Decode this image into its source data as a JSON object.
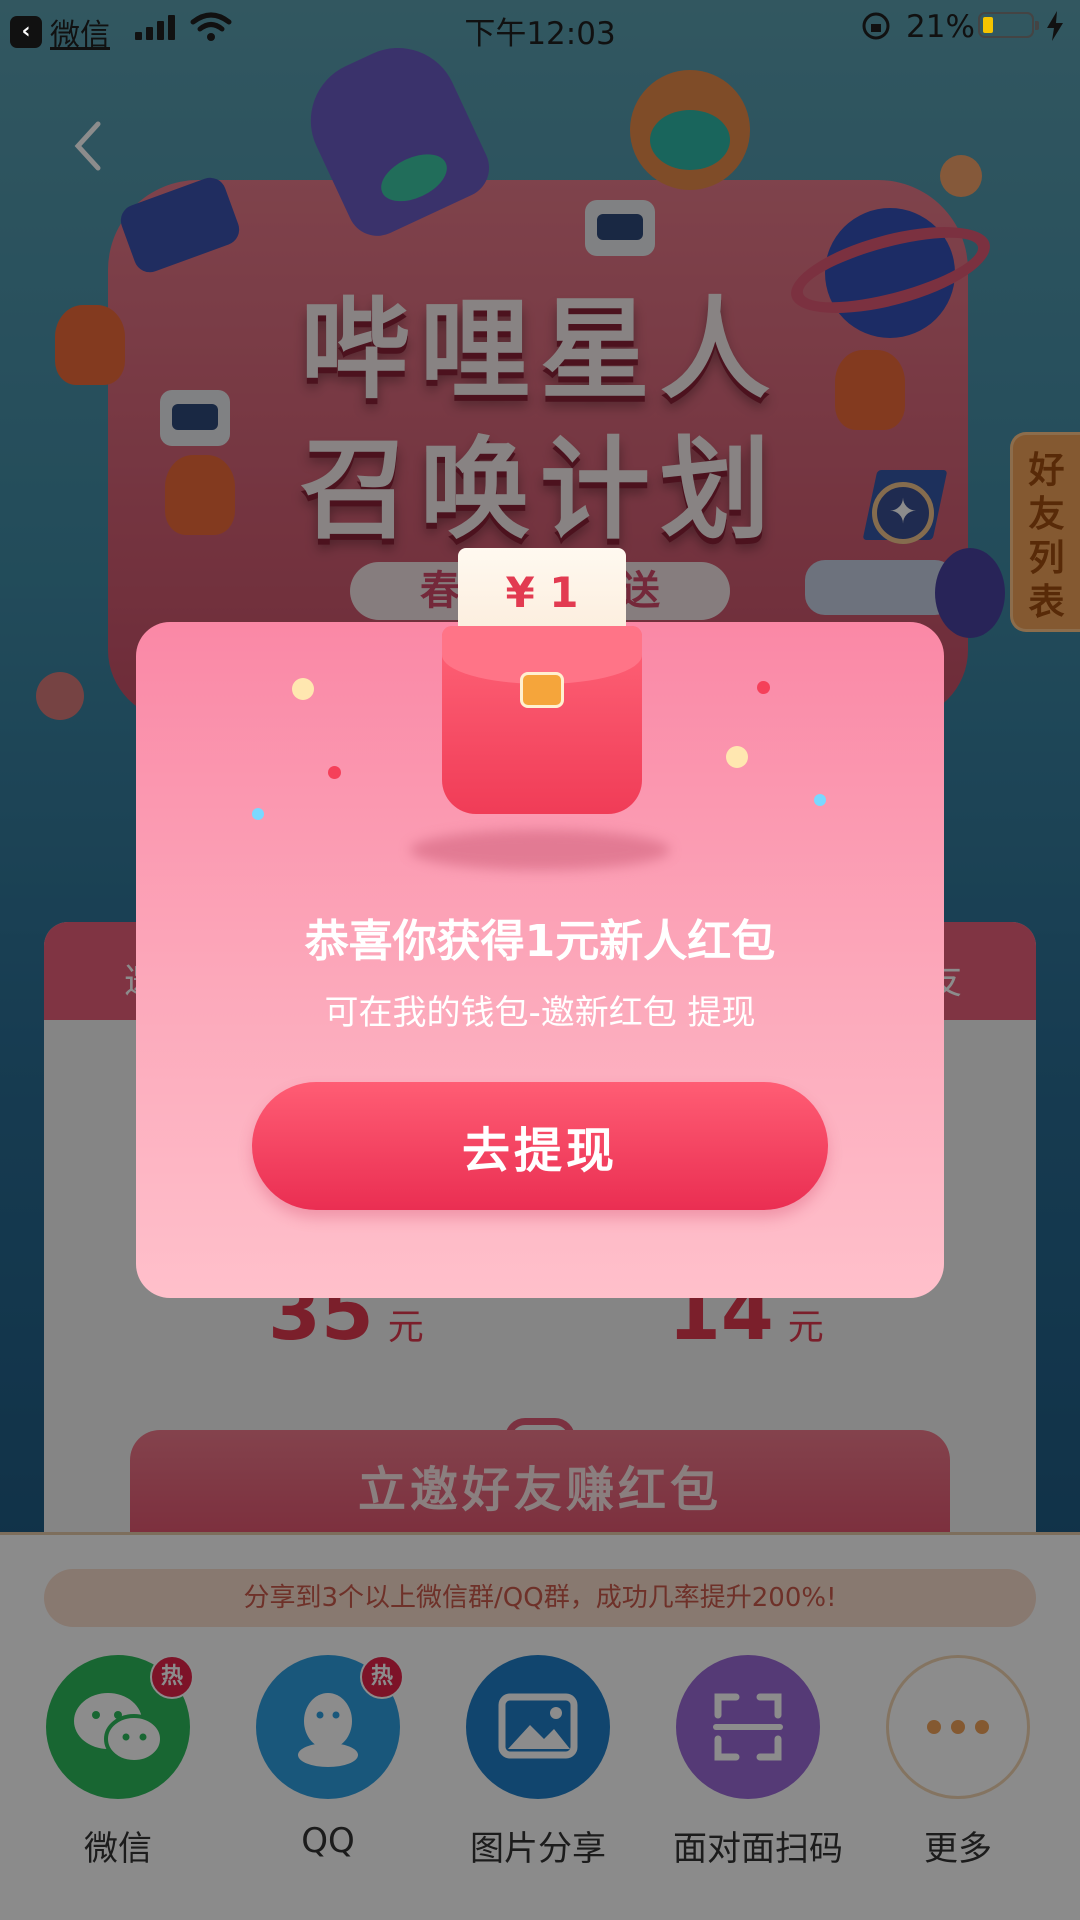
{
  "status_bar": {
    "back_app": "微信",
    "time": "下午12:03",
    "battery_percent": "21%",
    "battery_level": 0.21
  },
  "hero": {
    "title_line1": "哔哩星人",
    "title_line2": "召唤计划",
    "subtitle": "春节红包敌送"
  },
  "side_tab": {
    "label": "好友列表"
  },
  "card": {
    "header_left": "邀",
    "header_right": "友",
    "amount_left": "35",
    "amount_right": "14",
    "unit": "元",
    "invite_button": "立邀好友赚红包"
  },
  "share": {
    "tip": "分享到3个以上微信群/QQ群，成功几率提升200%!",
    "hot_badge": "热",
    "items": [
      {
        "label": "微信",
        "icon": "wechat-icon"
      },
      {
        "label": "QQ",
        "icon": "qq-icon"
      },
      {
        "label": "图片分享",
        "icon": "image-icon"
      },
      {
        "label": "面对面扫码",
        "icon": "scan-icon"
      },
      {
        "label": "更多",
        "icon": "more-icon"
      }
    ]
  },
  "modal": {
    "envelope_amount": "¥ 1",
    "title": "恭喜你获得1元新人红包",
    "subtitle": "可在我的钱包-邀新红包 提现",
    "button": "去提现"
  },
  "colors": {
    "accent": "#ea2e52",
    "modal_bg": "#fca9bb",
    "battery": "#f5c400"
  }
}
